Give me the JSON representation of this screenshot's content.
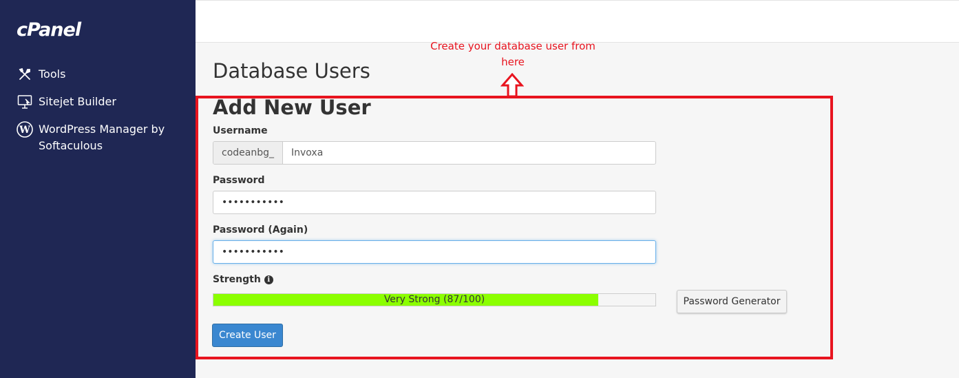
{
  "sidebar": {
    "logo": "cPanel",
    "items": [
      {
        "label": "Tools",
        "icon": "tools-icon"
      },
      {
        "label": "Sitejet Builder",
        "icon": "monitor-icon"
      },
      {
        "label": "WordPress Manager by Softaculous",
        "icon": "wordpress-icon"
      }
    ]
  },
  "annotation": {
    "text": "Create your database user from here",
    "color": "#e8141f"
  },
  "page": {
    "title": "Database Users",
    "section_title": "Add New User"
  },
  "form": {
    "username_label": "Username",
    "username_prefix": "codeanbg_",
    "username_value": "Invoxa",
    "password_label": "Password",
    "password_value": "•••••••••••",
    "password_again_label": "Password (Again)",
    "password_again_value": "•••••••••••",
    "strength_label": "Strength",
    "strength_text": "Very Strong (87/100)",
    "strength_score": 87,
    "strength_color": "#8bff00",
    "generator_label": "Password Generator",
    "create_label": "Create User"
  },
  "colors": {
    "sidebar_bg": "#1f2754",
    "primary_button": "#3a87d0",
    "highlight": "#e8141f"
  }
}
